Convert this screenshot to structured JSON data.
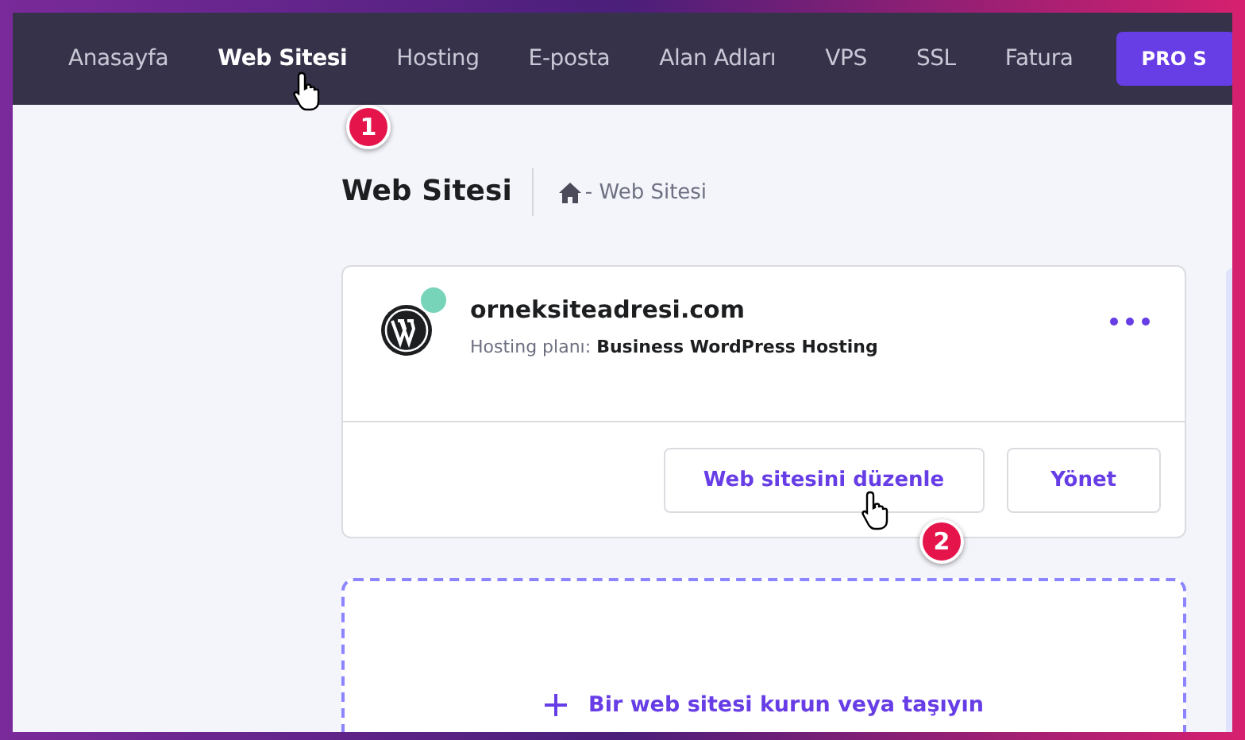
{
  "nav": {
    "items": [
      {
        "label": "Anasayfa",
        "selected": false
      },
      {
        "label": "Web Sitesi",
        "selected": true
      },
      {
        "label": "Hosting",
        "selected": false
      },
      {
        "label": "E-posta",
        "selected": false
      },
      {
        "label": "Alan Adları",
        "selected": false
      },
      {
        "label": "VPS",
        "selected": false
      },
      {
        "label": "SSL",
        "selected": false
      },
      {
        "label": "Fatura",
        "selected": false
      }
    ],
    "pro_button": "PRO S"
  },
  "page": {
    "title": "Web Sitesi",
    "breadcrumb": "- Web Sitesi"
  },
  "website_card": {
    "domain": "orneksiteadresi.com",
    "plan_label": "Hosting planı:",
    "plan_name": "Business WordPress Hosting",
    "online": true,
    "buttons": [
      "Web sitesini düzenle",
      "Yönet"
    ]
  },
  "add_site": {
    "label": "Bir web sitesi kurun veya taşıyın"
  },
  "step_badges": [
    "1",
    "2"
  ]
}
